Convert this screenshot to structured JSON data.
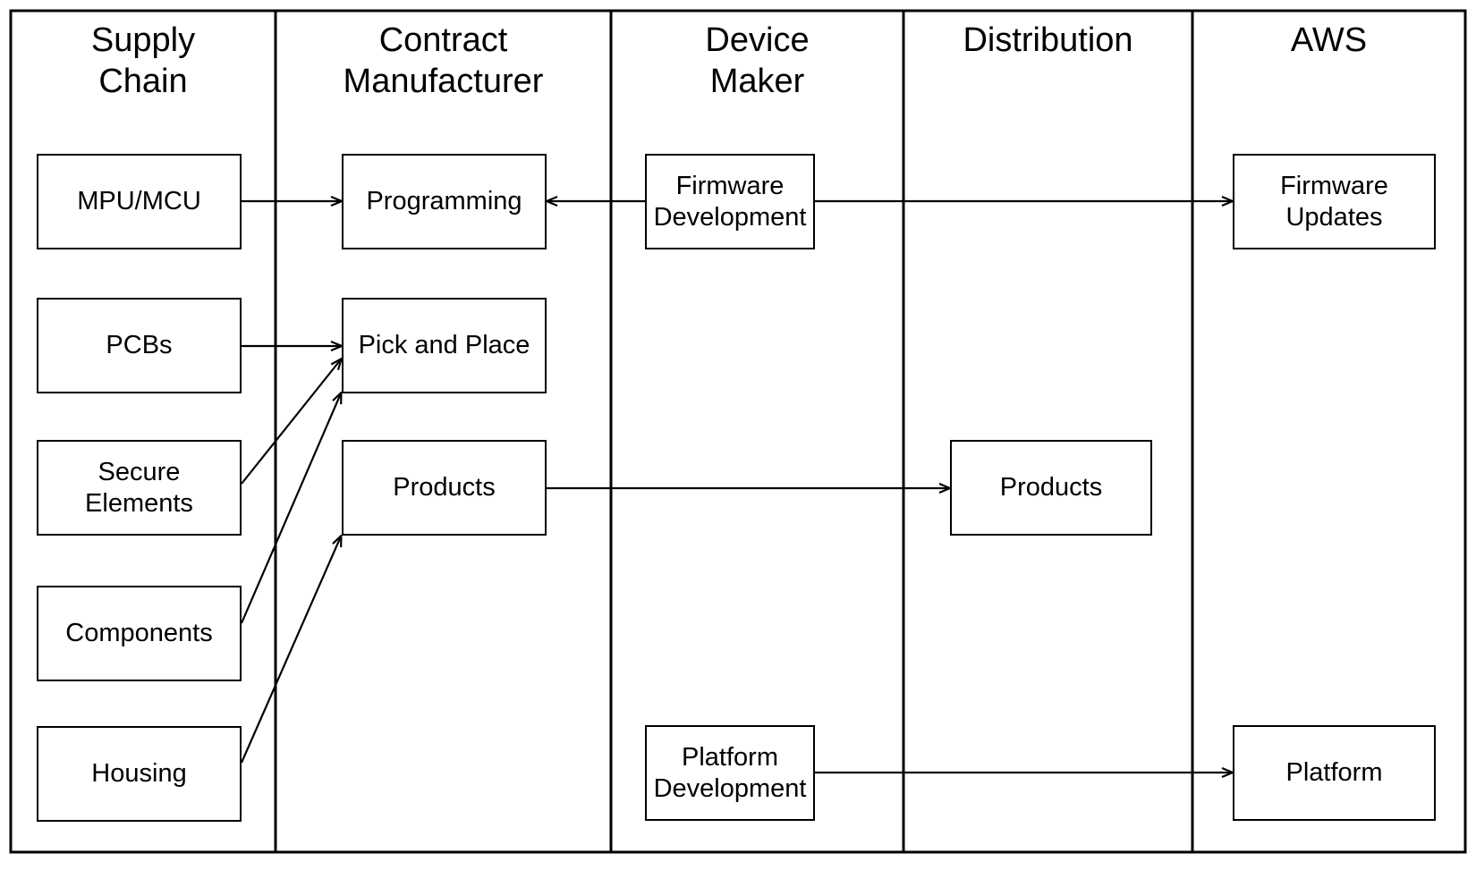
{
  "diagram": {
    "type": "swimlane-flow",
    "frame": {
      "stroke": "#000000",
      "background": "#ffffff"
    },
    "swimlanes": [
      {
        "id": "supply-chain",
        "title": "Supply\nChain"
      },
      {
        "id": "contract-manufacturer",
        "title": "Contract\nManufacturer"
      },
      {
        "id": "device-maker",
        "title": "Device\nMaker"
      },
      {
        "id": "distribution",
        "title": "Distribution"
      },
      {
        "id": "aws",
        "title": "AWS"
      }
    ],
    "nodes": [
      {
        "id": "mpu-mcu",
        "lane": "supply-chain",
        "label": "MPU/MCU"
      },
      {
        "id": "pcbs",
        "lane": "supply-chain",
        "label": "PCBs"
      },
      {
        "id": "secure-elements",
        "lane": "supply-chain",
        "label": "Secure\nElements"
      },
      {
        "id": "components",
        "lane": "supply-chain",
        "label": "Components"
      },
      {
        "id": "housing",
        "lane": "supply-chain",
        "label": "Housing"
      },
      {
        "id": "programming",
        "lane": "contract-manufacturer",
        "label": "Programming"
      },
      {
        "id": "pick-and-place",
        "lane": "contract-manufacturer",
        "label": "Pick and Place"
      },
      {
        "id": "cm-products",
        "lane": "contract-manufacturer",
        "label": "Products"
      },
      {
        "id": "firmware-development",
        "lane": "device-maker",
        "label": "Firmware\nDevelopment"
      },
      {
        "id": "platform-development",
        "lane": "device-maker",
        "label": "Platform\nDevelopment"
      },
      {
        "id": "dist-products",
        "lane": "distribution",
        "label": "Products"
      },
      {
        "id": "firmware-updates",
        "lane": "aws",
        "label": "Firmware\nUpdates"
      },
      {
        "id": "platform",
        "lane": "aws",
        "label": "Platform"
      }
    ],
    "edges": [
      {
        "from": "mpu-mcu",
        "to": "programming",
        "style": "straight"
      },
      {
        "from": "firmware-development",
        "to": "programming",
        "style": "straight"
      },
      {
        "from": "firmware-development",
        "to": "firmware-updates",
        "style": "straight"
      },
      {
        "from": "pcbs",
        "to": "pick-and-place",
        "style": "straight"
      },
      {
        "from": "secure-elements",
        "to": "pick-and-place",
        "style": "diagonal"
      },
      {
        "from": "components",
        "to": "pick-and-place",
        "style": "diagonal"
      },
      {
        "from": "housing",
        "to": "cm-products",
        "style": "diagonal"
      },
      {
        "from": "cm-products",
        "to": "dist-products",
        "style": "straight"
      },
      {
        "from": "platform-development",
        "to": "platform",
        "style": "straight"
      }
    ]
  }
}
